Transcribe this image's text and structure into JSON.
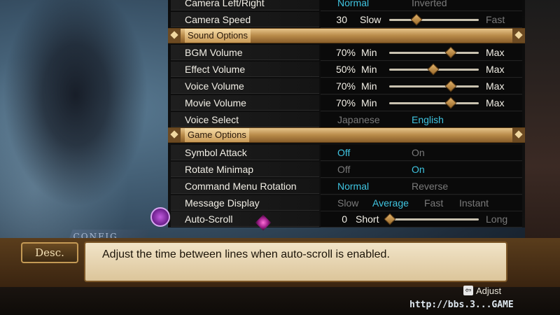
{
  "rows_top": [
    {
      "label": "Camera Left/Right",
      "options": [
        "Normal",
        "Inverted"
      ],
      "selected": 0
    },
    {
      "label": "Camera Speed",
      "value": "30",
      "min": "Slow",
      "max": "Fast",
      "level": 0.3
    }
  ],
  "sound_header": "Sound Options",
  "sound_rows": [
    {
      "label": "BGM Volume",
      "value": "70%",
      "min": "Min",
      "max": "Max",
      "level": 0.7
    },
    {
      "label": "Effect Volume",
      "value": "50%",
      "min": "Min",
      "max": "Max",
      "level": 0.5
    },
    {
      "label": "Voice Volume",
      "value": "70%",
      "min": "Min",
      "max": "Max",
      "level": 0.7
    },
    {
      "label": "Movie Volume",
      "value": "70%",
      "min": "Min",
      "max": "Max",
      "level": 0.7
    },
    {
      "label": "Voice Select",
      "options": [
        "Japanese",
        "English"
      ],
      "selected": 1
    }
  ],
  "game_header": "Game Options",
  "game_rows": [
    {
      "label": "Symbol Attack",
      "options": [
        "Off",
        "On"
      ],
      "selected": 0
    },
    {
      "label": "Rotate Minimap",
      "options": [
        "Off",
        "On"
      ],
      "selected": 1
    },
    {
      "label": "Command Menu Rotation",
      "options": [
        "Normal",
        "Reverse"
      ],
      "selected": 0
    },
    {
      "label": "Message Display",
      "options": [
        "Slow",
        "Average",
        "Fast",
        "Instant"
      ],
      "selected": 1
    },
    {
      "label": "Auto-Scroll",
      "value": "0",
      "min": "Short",
      "max": "Long",
      "level": 0.0
    }
  ],
  "config_label": "CONFIG",
  "desc_label": "Desc.",
  "desc_text": "Adjust the time between lines when auto-scroll is enabled.",
  "adjust_label": "Adjust",
  "watermark": "http://bbs.3...GAME",
  "colors": {
    "selected": "#3fc4e0",
    "dim": "#7a7a7a",
    "header_gold": "#c99a56"
  }
}
